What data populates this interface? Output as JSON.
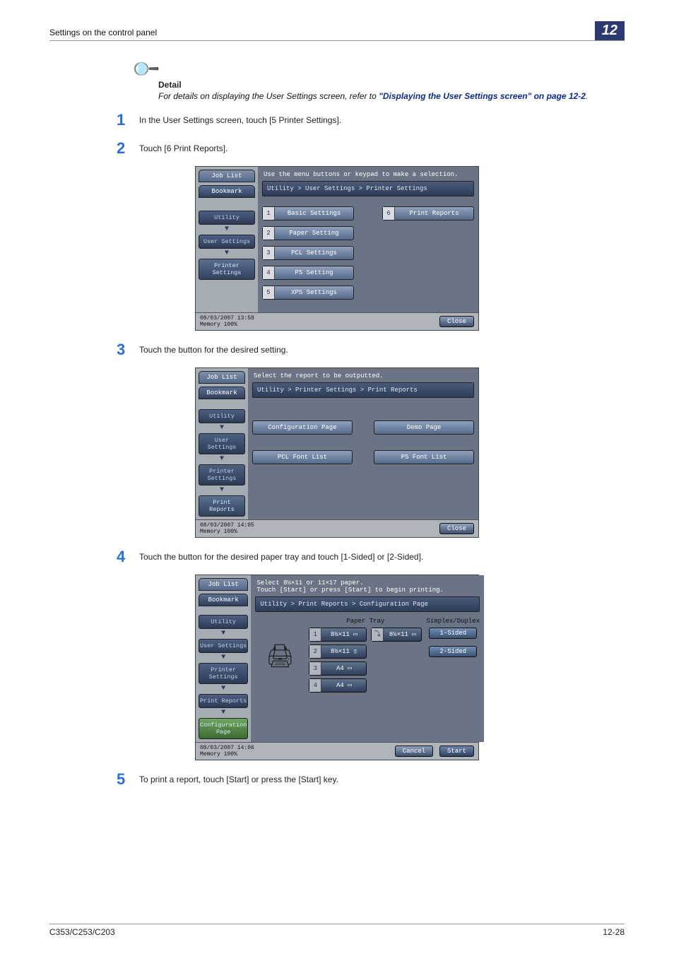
{
  "header": {
    "title": "Settings on the control panel",
    "badge": "12"
  },
  "detail": {
    "label": "Detail",
    "text_prefix": "For details on displaying the User Settings screen, refer to ",
    "link": "\"Displaying the User Settings screen\" on page 12-2",
    "period": "."
  },
  "steps": {
    "s1": "In the User Settings screen, touch [5 Printer Settings].",
    "s2": "Touch [6 Print Reports].",
    "s3": "Touch the button for the desired setting.",
    "s4": "Touch the button for the desired paper tray and touch [1-Sided] or [2-Sided].",
    "s5": "To print a report, touch [Start] or press the [Start] key."
  },
  "shot1": {
    "hint": "Use the menu buttons or keypad to make a selection.",
    "breadcrumb": "Utility > User Settings > Printer Settings",
    "left": {
      "jobList": "Job List",
      "bookmark": "Bookmark",
      "c1": "Utility",
      "c2": "User Settings",
      "c3": "Printer Settings"
    },
    "menu": {
      "n1": "1",
      "l1": "Basic Settings",
      "n2": "2",
      "l2": "Paper Setting",
      "n3": "3",
      "l3": "PCL Settings",
      "n4": "4",
      "l4": "PS Setting",
      "n5": "5",
      "l5": "XPS Settings",
      "n6": "6",
      "l6": "Print Reports"
    },
    "footer": {
      "dt": "08/03/2007   13:58",
      "mem": "Memory      100%",
      "close": "Close"
    }
  },
  "shot2": {
    "hint": "Select the report to be outputted.",
    "breadcrumb": "Utility > Printer Settings > Print Reports",
    "left": {
      "jobList": "Job List",
      "bookmark": "Bookmark",
      "c1": "Utility",
      "c2": "User Settings",
      "c3": "Printer Settings",
      "c4": "Print Reports"
    },
    "menu": {
      "b1": "Configuration Page",
      "b2": "Demo Page",
      "b3": "PCL Font List",
      "b4": "PS Font List"
    },
    "footer": {
      "dt": "08/03/2007   14:05",
      "mem": "Memory      100%",
      "close": "Close"
    }
  },
  "shot3": {
    "hint1": "Select 8½×11 or 11×17 paper.",
    "hint2": "Touch [Start] or press [Start] to begin printing.",
    "breadcrumb": "Utility > Print Reports > Configuration Page",
    "left": {
      "jobList": "Job List",
      "bookmark": "Bookmark",
      "c1": "Utility",
      "c2": "User Settings",
      "c3": "Printer Settings",
      "c4": "Print Reports",
      "c5": "Configuration Page"
    },
    "headers": {
      "tray": "Paper Tray",
      "duplex": "Simplex/Duplex"
    },
    "trays": {
      "n1": "1",
      "l1": "8½×11 ▭",
      "n1b": "",
      "l1b": "8½×11 ▭",
      "n2": "2",
      "l2": "8½×11 ▯",
      "n3": "3",
      "l3": "A4 ▭",
      "n4": "4",
      "l4": "A4 ▭"
    },
    "side": {
      "s1": "1-Sided",
      "s2": "2-Sided"
    },
    "footer": {
      "dt": "08/03/2007   14:06",
      "mem": "Memory      100%",
      "cancel": "Cancel",
      "start": "Start"
    }
  },
  "footer": {
    "model": "C353/C253/C203",
    "page": "12-28"
  }
}
